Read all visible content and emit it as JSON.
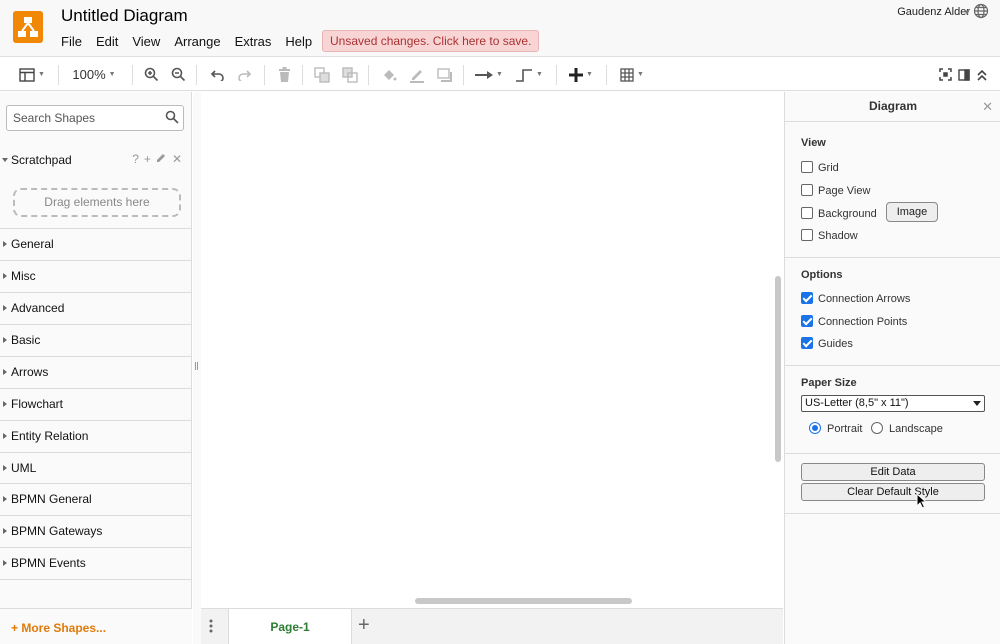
{
  "app": {
    "title": "Untitled Diagram",
    "user": "Gaudenz Alder",
    "unsaved": "Unsaved changes. Click here to save.",
    "accent": "#f08705"
  },
  "menu": [
    "File",
    "Edit",
    "View",
    "Arrange",
    "Extras",
    "Help"
  ],
  "toolbar": {
    "zoom": "100%"
  },
  "sidebar": {
    "search_placeholder": "Search Shapes",
    "scratchpad": {
      "label": "Scratchpad",
      "help": "?",
      "add": "+",
      "close": "✕",
      "drop_hint": "Drag elements here"
    },
    "sections": [
      "General",
      "Misc",
      "Advanced",
      "Basic",
      "Arrows",
      "Flowchart",
      "Entity Relation",
      "UML",
      "BPMN General",
      "BPMN Gateways",
      "BPMN Events"
    ],
    "more_shapes": "+ More Shapes..."
  },
  "pages": {
    "tabs": [
      "Page-1"
    ],
    "add": "+"
  },
  "panel": {
    "title": "Diagram",
    "view": {
      "title": "View",
      "grid": {
        "label": "Grid",
        "checked": false
      },
      "page_view": {
        "label": "Page View",
        "checked": false
      },
      "background": {
        "label": "Background",
        "checked": false
      },
      "image_button": "Image",
      "shadow": {
        "label": "Shadow",
        "checked": false
      }
    },
    "options": {
      "title": "Options",
      "connection_arrows": {
        "label": "Connection Arrows",
        "checked": true
      },
      "connection_points": {
        "label": "Connection Points",
        "checked": true
      },
      "guides": {
        "label": "Guides",
        "checked": true
      }
    },
    "paper": {
      "title": "Paper Size",
      "size": "US-Letter (8,5\" x 11\")",
      "portrait": "Portrait",
      "landscape": "Landscape",
      "orientation": "portrait"
    },
    "edit_data": "Edit Data",
    "clear_default_style": "Clear Default Style"
  }
}
